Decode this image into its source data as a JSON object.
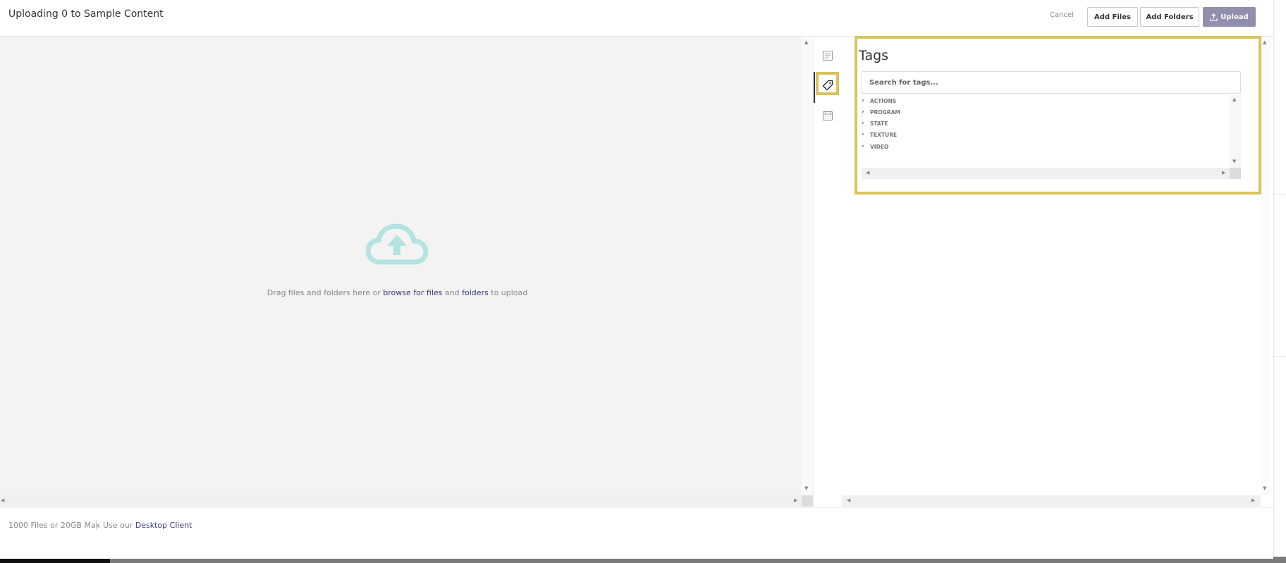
{
  "header": {
    "title": "Uploading 0 to Sample Content",
    "cancel_label": "Cancel",
    "add_files_label": "Add Files",
    "add_folders_label": "Add Folders",
    "upload_label": "Upload"
  },
  "dropzone": {
    "icon": "cloud-upload-icon",
    "text_before": "Drag files and folders here or ",
    "browse_files_link": "browse for files",
    "text_and": " and ",
    "folders_link": "folders",
    "text_after": " to upload"
  },
  "rail": {
    "icons": [
      "details-icon",
      "tag-icon",
      "calendar-icon"
    ],
    "active": "tag-icon"
  },
  "tags_panel": {
    "title": "Tags",
    "search_placeholder": "Search for tags...",
    "items": [
      "ACTIONS",
      "PROGRAM",
      "STATE",
      "TEXTURE",
      "VIDEO"
    ]
  },
  "footer": {
    "limit_text": "1000 Files or 20GB Max",
    "client_prefix": "Use our ",
    "client_link": "Desktop Client"
  },
  "colors": {
    "highlight": "#d8c35e",
    "upload_button": "#9090ad",
    "cloud_icon": "#b4e3e2",
    "link": "#3a3a7a"
  }
}
